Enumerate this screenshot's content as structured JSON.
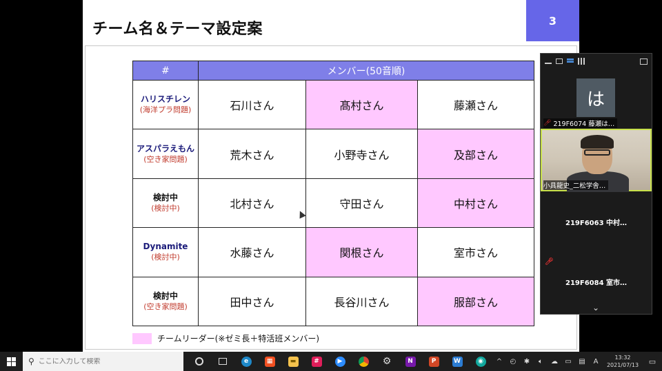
{
  "slide": {
    "title": "チーム名＆テーマ設定案",
    "page_number": "3",
    "table": {
      "header_left": "#",
      "header_right": "メンバー(50音順)",
      "rows": [
        {
          "team": "ハリスチレン",
          "theme": "(海洋プラ問題)",
          "members": [
            "石川さん",
            "髙村さん",
            "藤瀬さん"
          ],
          "leader_index": 1
        },
        {
          "team": "アスパラえもん",
          "theme": "(空き家問題)",
          "members": [
            "荒木さん",
            "小野寺さん",
            "及部さん"
          ],
          "leader_index": 2
        },
        {
          "team": "検討中",
          "theme": "(検討中)",
          "members": [
            "北村さん",
            "守田さん",
            "中村さん"
          ],
          "leader_index": 2
        },
        {
          "team": "Dynamite",
          "theme": "(検討中)",
          "members": [
            "水藤さん",
            "関根さん",
            "室市さん"
          ],
          "leader_index": 1
        },
        {
          "team": "検討中",
          "theme": "(空き家問題)",
          "members": [
            "田中さん",
            "長谷川さん",
            "服部さん"
          ],
          "leader_index": 2
        }
      ]
    },
    "legend": "チームリーダー(※ゼミ長＋特活班メンバー)",
    "colors": {
      "header": "#7f7fe8",
      "leader": "#ffc8ff",
      "page_badge": "#6666e8",
      "team_name": "#1b1b7a",
      "theme": "#c0392b"
    }
  },
  "zoom": {
    "participants": [
      {
        "avatar_letter": "は",
        "label": "219F6074 藤瀬は…",
        "muted": true
      },
      {
        "label": "小具龍史_二松学舎…",
        "muted": false,
        "video": true,
        "active_speaker": true
      },
      {
        "label": "219F6063 中村…",
        "muted": false
      },
      {
        "label": "219F6084 室市…",
        "muted": true
      }
    ],
    "scroll_icon": "chevron-down-icon"
  },
  "taskbar": {
    "search_placeholder": "ここに入力して検索",
    "ime": "A",
    "time": "13:32",
    "date": "2021/07/13"
  }
}
